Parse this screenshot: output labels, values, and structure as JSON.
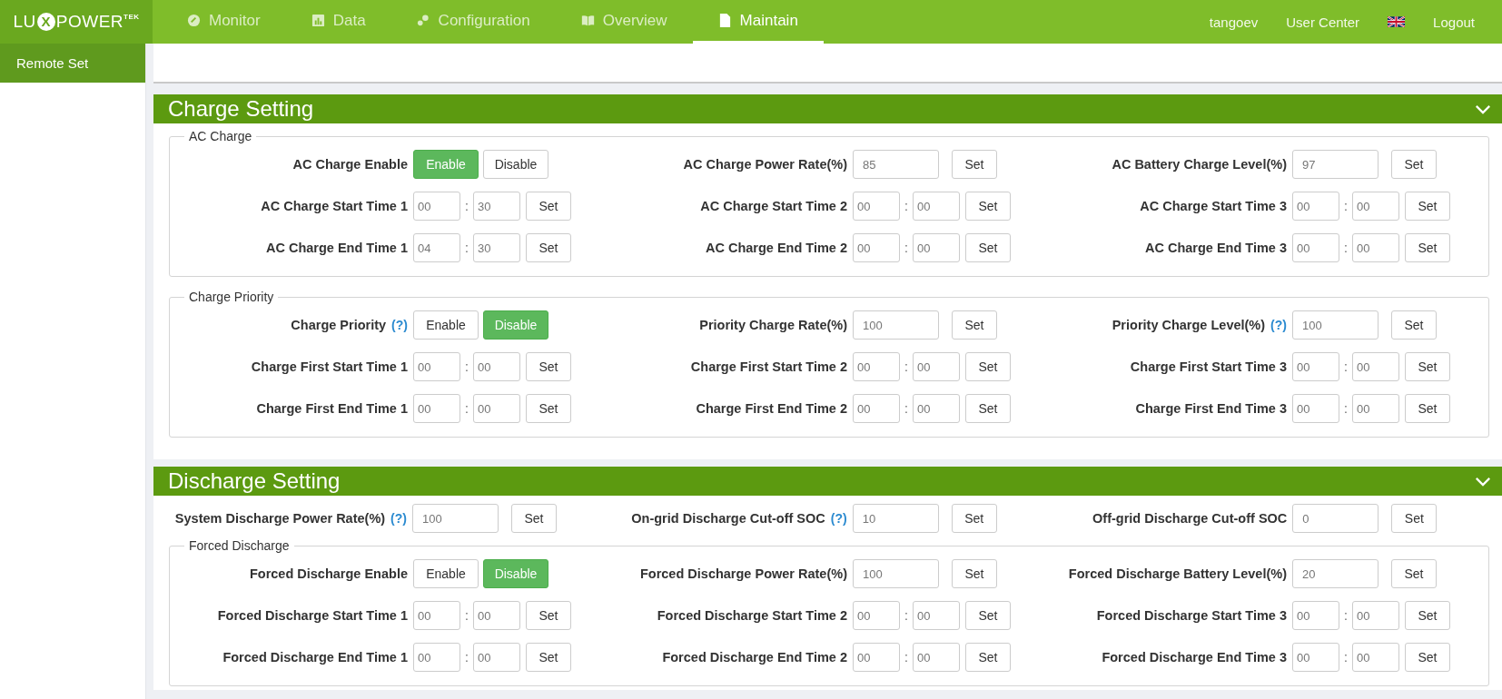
{
  "logo": {
    "start": "LU",
    "mark": "X",
    "end": "POWER",
    "sup": "TEK"
  },
  "nav": [
    {
      "label": "Monitor",
      "selected": false
    },
    {
      "label": "Data",
      "selected": false
    },
    {
      "label": "Configuration",
      "selected": false
    },
    {
      "label": "Overview",
      "selected": false
    },
    {
      "label": "Maintain",
      "selected": true
    }
  ],
  "user": {
    "name": "tangoev",
    "center": "User Center",
    "logout": "Logout"
  },
  "sidebar": {
    "items": [
      {
        "label": "Remote Set",
        "selected": true
      }
    ]
  },
  "sections": [
    {
      "title": "Charge Setting",
      "expanded": true,
      "groups": [
        {
          "legend": "AC Charge",
          "rows": [
            [
              {
                "kind": "toggle",
                "label": "AC Charge Enable",
                "options": [
                  {
                    "label": "Enable",
                    "selected": true
                  },
                  {
                    "label": "Disable",
                    "selected": false
                  }
                ]
              },
              {
                "kind": "value",
                "label": "AC Charge Power Rate(%)",
                "value": "85",
                "button": "Set"
              },
              {
                "kind": "value",
                "label": "AC Battery Charge Level(%)",
                "value": "97",
                "button": "Set"
              }
            ],
            [
              {
                "kind": "time",
                "label": "AC Charge Start Time 1",
                "hour": "00",
                "sep": ":",
                "minute": "30",
                "button": "Set"
              },
              {
                "kind": "time",
                "label": "AC Charge Start Time 2",
                "hour": "00",
                "sep": ":",
                "minute": "00",
                "button": "Set"
              },
              {
                "kind": "time",
                "label": "AC Charge Start Time 3",
                "hour": "00",
                "sep": ":",
                "minute": "00",
                "button": "Set"
              }
            ],
            [
              {
                "kind": "time",
                "label": "AC Charge End Time 1",
                "hour": "04",
                "sep": ":",
                "minute": "30",
                "button": "Set"
              },
              {
                "kind": "time",
                "label": "AC Charge End Time 2",
                "hour": "00",
                "sep": ":",
                "minute": "00",
                "button": "Set"
              },
              {
                "kind": "time",
                "label": "AC Charge End Time 3",
                "hour": "00",
                "sep": ":",
                "minute": "00",
                "button": "Set"
              }
            ]
          ]
        },
        {
          "legend": "Charge Priority",
          "rows": [
            [
              {
                "kind": "toggle",
                "label": "Charge Priority",
                "help": "(?)",
                "options": [
                  {
                    "label": "Enable",
                    "selected": false
                  },
                  {
                    "label": "Disable",
                    "selected": true
                  }
                ]
              },
              {
                "kind": "value",
                "label": "Priority Charge Rate(%)",
                "value": "100",
                "button": "Set"
              },
              {
                "kind": "value",
                "label": "Priority Charge Level(%)",
                "help": "(?)",
                "value": "100",
                "button": "Set"
              }
            ],
            [
              {
                "kind": "time",
                "label": "Charge First Start Time 1",
                "hour": "00",
                "sep": ":",
                "minute": "00",
                "button": "Set"
              },
              {
                "kind": "time",
                "label": "Charge First Start Time 2",
                "hour": "00",
                "sep": ":",
                "minute": "00",
                "button": "Set"
              },
              {
                "kind": "time",
                "label": "Charge First Start Time 3",
                "hour": "00",
                "sep": ":",
                "minute": "00",
                "button": "Set"
              }
            ],
            [
              {
                "kind": "time",
                "label": "Charge First End Time 1",
                "hour": "00",
                "sep": ":",
                "minute": "00",
                "button": "Set"
              },
              {
                "kind": "time",
                "label": "Charge First End Time 2",
                "hour": "00",
                "sep": ":",
                "minute": "00",
                "button": "Set"
              },
              {
                "kind": "time",
                "label": "Charge First End Time 3",
                "hour": "00",
                "sep": ":",
                "minute": "00",
                "button": "Set"
              }
            ]
          ]
        }
      ]
    },
    {
      "title": "Discharge Setting",
      "expanded": true,
      "rows": [
        [
          {
            "kind": "value",
            "label": "System Discharge Power Rate(%)",
            "help": "(?)",
            "value": "100",
            "button": "Set"
          },
          {
            "kind": "value",
            "label": "On-grid Discharge Cut-off SOC",
            "help": "(?)",
            "value": "10",
            "button": "Set"
          },
          {
            "kind": "value",
            "label": "Off-grid Discharge Cut-off SOC",
            "value": "0",
            "button": "Set"
          }
        ]
      ],
      "groups": [
        {
          "legend": "Forced Discharge",
          "rows": [
            [
              {
                "kind": "toggle",
                "label": "Forced Discharge Enable",
                "options": [
                  {
                    "label": "Enable",
                    "selected": false
                  },
                  {
                    "label": "Disable",
                    "selected": true
                  }
                ]
              },
              {
                "kind": "value",
                "label": "Forced Discharge Power Rate(%)",
                "value": "100",
                "button": "Set"
              },
              {
                "kind": "value",
                "label": "Forced Discharge Battery Level(%)",
                "value": "20",
                "button": "Set"
              }
            ],
            [
              {
                "kind": "time",
                "label": "Forced Discharge Start Time 1",
                "hour": "00",
                "sep": ":",
                "minute": "00",
                "button": "Set"
              },
              {
                "kind": "time",
                "label": "Forced Discharge Start Time 2",
                "hour": "00",
                "sep": ":",
                "minute": "00",
                "button": "Set"
              },
              {
                "kind": "time",
                "label": "Forced Discharge Start Time 3",
                "hour": "00",
                "sep": ":",
                "minute": "00",
                "button": "Set"
              }
            ],
            [
              {
                "kind": "time",
                "label": "Forced Discharge End Time 1",
                "hour": "00",
                "sep": ":",
                "minute": "00",
                "button": "Set"
              },
              {
                "kind": "time",
                "label": "Forced Discharge End Time 2",
                "hour": "00",
                "sep": ":",
                "minute": "00",
                "button": "Set"
              },
              {
                "kind": "time",
                "label": "Forced Discharge End Time 3",
                "hour": "00",
                "sep": ":",
                "minute": "00",
                "button": "Set"
              }
            ]
          ]
        }
      ]
    }
  ]
}
